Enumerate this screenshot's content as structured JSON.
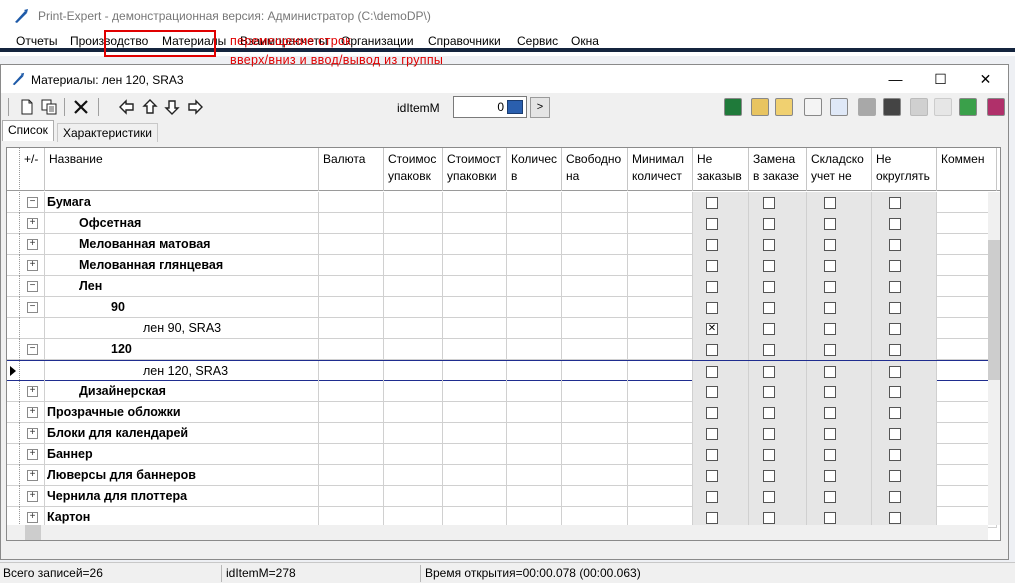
{
  "app": {
    "title": "Print-Expert - демонстрационная версия: Администратор (C:\\demoDP\\)"
  },
  "menu": [
    "Отчеты",
    "Производство",
    "Материалы",
    "Взаиморасчеты",
    "Организации",
    "Справочники",
    "Сервис",
    "Окна"
  ],
  "window": {
    "title": "Материалы: лен 120, SRA3",
    "minimize": "—",
    "maximize": "☐",
    "close": "✕"
  },
  "annotation": {
    "line1": "перемещение строк",
    "line2": "вверх/вниз и ввод/вывод из группы"
  },
  "id_field": {
    "label": "idItemM",
    "value": "0",
    "button": ">"
  },
  "tabs": [
    "Список",
    "Характеристики"
  ],
  "columns": [
    {
      "label": "+/-"
    },
    {
      "label": "Название"
    },
    {
      "label": "Валюта"
    },
    {
      "label": "Стоимос\nупаковк"
    },
    {
      "label": "Стоимост\nупаковки"
    },
    {
      "label": "Количес\nв"
    },
    {
      "label": "Свободно\nна"
    },
    {
      "label": "Минимал\nколичест"
    },
    {
      "label": "Не\nзаказыв"
    },
    {
      "label": "Замена\nв заказе"
    },
    {
      "label": "Складско\nучет не"
    },
    {
      "label": "Не\nокруглять"
    },
    {
      "label": "Коммен"
    }
  ],
  "rows": [
    {
      "name": "Бумага",
      "level": 0,
      "exp": "−",
      "bold": true,
      "checks": [
        false,
        false,
        false,
        false
      ]
    },
    {
      "name": "Офсетная",
      "level": 1,
      "exp": "+",
      "bold": true,
      "checks": [
        false,
        false,
        false,
        false
      ]
    },
    {
      "name": "Мелованная матовая",
      "level": 1,
      "exp": "+",
      "bold": true,
      "checks": [
        false,
        false,
        false,
        false
      ]
    },
    {
      "name": "Мелованная глянцевая",
      "level": 1,
      "exp": "+",
      "bold": true,
      "checks": [
        false,
        false,
        false,
        false
      ]
    },
    {
      "name": "Лен",
      "level": 1,
      "exp": "−",
      "bold": true,
      "checks": [
        false,
        false,
        false,
        false
      ]
    },
    {
      "name": "90",
      "level": 2,
      "exp": "−",
      "bold": true,
      "checks": [
        false,
        false,
        false,
        false
      ]
    },
    {
      "name": "лен 90, SRA3",
      "level": 3,
      "exp": "",
      "bold": false,
      "checks": [
        true,
        false,
        false,
        false
      ]
    },
    {
      "name": "120",
      "level": 2,
      "exp": "−",
      "bold": true,
      "checks": [
        false,
        false,
        false,
        false
      ]
    },
    {
      "name": "лен 120, SRA3",
      "level": 3,
      "exp": "",
      "bold": false,
      "selected": true,
      "checks": [
        false,
        false,
        false,
        false
      ]
    },
    {
      "name": "Дизайнерская",
      "level": 1,
      "exp": "+",
      "bold": true,
      "checks": [
        false,
        false,
        false,
        false
      ]
    },
    {
      "name": "Прозрачные обложки",
      "level": 0,
      "exp": "+",
      "bold": true,
      "checks": [
        false,
        false,
        false,
        false
      ]
    },
    {
      "name": "Блоки для календарей",
      "level": 0,
      "exp": "+",
      "bold": true,
      "checks": [
        false,
        false,
        false,
        false
      ]
    },
    {
      "name": "Баннер",
      "level": 0,
      "exp": "+",
      "bold": true,
      "checks": [
        false,
        false,
        false,
        false
      ]
    },
    {
      "name": "Люверсы для баннеров",
      "level": 0,
      "exp": "+",
      "bold": true,
      "checks": [
        false,
        false,
        false,
        false
      ]
    },
    {
      "name": "Чернила для плоттера",
      "level": 0,
      "exp": "+",
      "bold": true,
      "checks": [
        false,
        false,
        false,
        false
      ]
    },
    {
      "name": "Картон",
      "level": 0,
      "exp": "+",
      "bold": true,
      "checks": [
        false,
        false,
        false,
        false
      ]
    }
  ],
  "status": {
    "records": "Всего записей=26",
    "id": "idItemM=278",
    "time": "Время открытия=00:00.078 (00:00.063)"
  }
}
